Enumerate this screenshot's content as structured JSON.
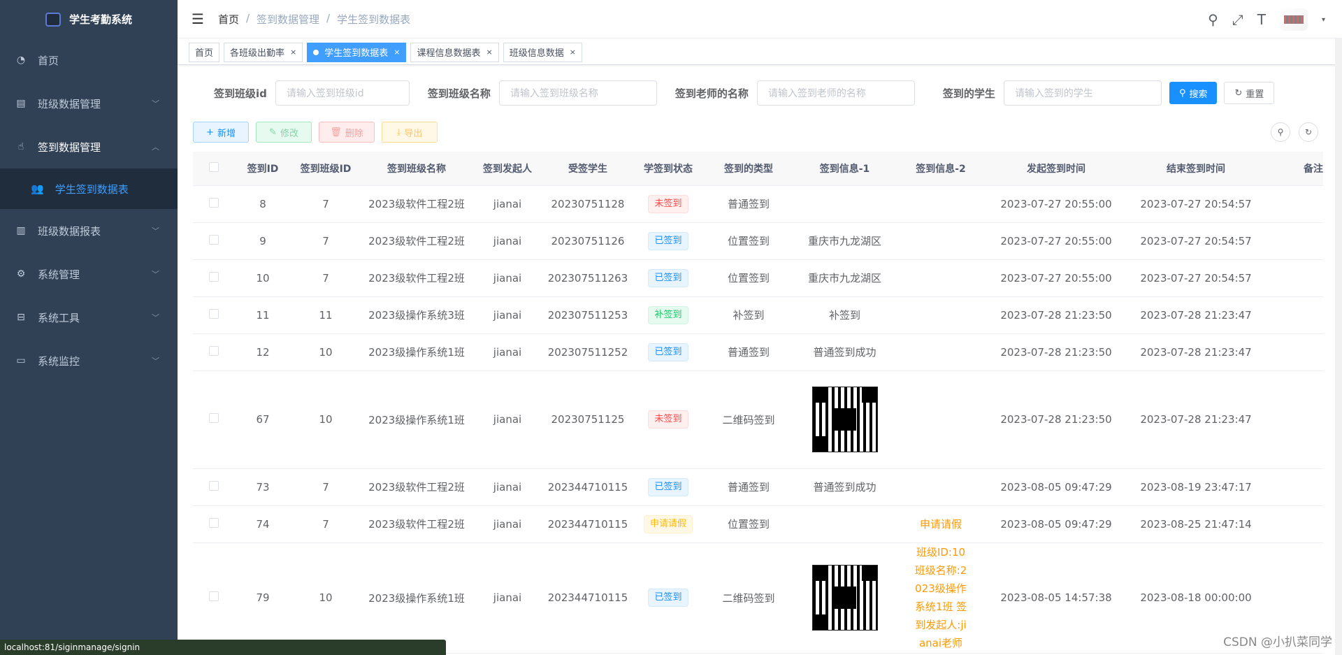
{
  "app": {
    "title": "学生考勤系统"
  },
  "sidebar": {
    "items": [
      {
        "label": "首页"
      },
      {
        "label": "班级数据管理"
      },
      {
        "label": "签到数据管理"
      },
      {
        "label": "学生签到数据表"
      },
      {
        "label": "班级数据报表"
      },
      {
        "label": "系统管理"
      },
      {
        "label": "系统工具"
      },
      {
        "label": "系统监控"
      }
    ]
  },
  "breadcrumb": {
    "home": "首页",
    "sep": "/",
    "level1": "签到数据管理",
    "level2": "学生签到数据表"
  },
  "tabs": [
    {
      "label": "首页"
    },
    {
      "label": "各班级出勤率"
    },
    {
      "label": "学生签到数据表"
    },
    {
      "label": "课程信息数据表"
    },
    {
      "label": "班级信息数据"
    }
  ],
  "search": {
    "f1_label": "签到班级id",
    "f1_placeholder": "请输入签到班级id",
    "f2_label": "签到班级名称",
    "f2_placeholder": "请输入签到班级名称",
    "f3_label": "签到老师的名称",
    "f3_placeholder": "请输入签到老师的名称",
    "f4_label": "签到的学生",
    "f4_placeholder": "请输入签到的学生",
    "search_btn": "搜索",
    "reset_btn": "重置"
  },
  "toolbar": {
    "add": "新增",
    "edit": "修改",
    "delete": "删除",
    "export": "导出"
  },
  "table": {
    "headers": [
      "签到ID",
      "签到班级ID",
      "签到班级名称",
      "签到发起人",
      "受签学生",
      "学签到状态",
      "签到的类型",
      "签到信息-1",
      "签到信息-2",
      "发起签到时间",
      "结束签到时间",
      "备注"
    ],
    "rows": [
      {
        "id": "8",
        "cls": "7",
        "name": "2023级软件工程2班",
        "init": "jianai",
        "stu": "20230751128",
        "status": "未签到",
        "type": "普通签到",
        "info1": "",
        "info2": "",
        "start": "2023-07-27 20:55:00",
        "end": "2023-07-27 20:54:57"
      },
      {
        "id": "9",
        "cls": "7",
        "name": "2023级软件工程2班",
        "init": "jianai",
        "stu": "20230751126",
        "status": "已签到",
        "type": "位置签到",
        "info1": "重庆市九龙湖区",
        "info2": "",
        "start": "2023-07-27 20:55:00",
        "end": "2023-07-27 20:54:57"
      },
      {
        "id": "10",
        "cls": "7",
        "name": "2023级软件工程2班",
        "init": "jianai",
        "stu": "202307511263",
        "status": "已签到",
        "type": "位置签到",
        "info1": "重庆市九龙湖区",
        "info2": "",
        "start": "2023-07-27 20:55:00",
        "end": "2023-07-27 20:54:57"
      },
      {
        "id": "11",
        "cls": "11",
        "name": "2023级操作系统3班",
        "init": "jianai",
        "stu": "202307511253",
        "status": "补签到",
        "type": "补签到",
        "info1": "补签到",
        "info2": "",
        "start": "2023-07-28 21:23:50",
        "end": "2023-07-28 21:23:47"
      },
      {
        "id": "12",
        "cls": "10",
        "name": "2023级操作系统1班",
        "init": "jianai",
        "stu": "202307511252",
        "status": "已签到",
        "type": "普通签到",
        "info1": "普通签到成功",
        "info2": "",
        "start": "2023-07-28 21:23:50",
        "end": "2023-07-28 21:23:47"
      },
      {
        "id": "67",
        "cls": "10",
        "name": "2023级操作系统1班",
        "init": "jianai",
        "stu": "20230751125",
        "status": "未签到",
        "type": "二维码签到",
        "info1": "",
        "info2": "",
        "start": "2023-07-28 21:23:50",
        "end": "2023-07-28 21:23:47"
      },
      {
        "id": "73",
        "cls": "7",
        "name": "2023级软件工程2班",
        "init": "jianai",
        "stu": "202344710115",
        "status": "已签到",
        "type": "普通签到",
        "info1": "普通签到成功",
        "info2": "",
        "start": "2023-08-05 09:47:29",
        "end": "2023-08-19 23:47:17"
      },
      {
        "id": "74",
        "cls": "7",
        "name": "2023级软件工程2班",
        "init": "jianai",
        "stu": "202344710115",
        "status": "申请请假",
        "type": "位置签到",
        "info1": "",
        "info2": "申请请假",
        "start": "2023-08-05 09:47:29",
        "end": "2023-08-25 21:47:14"
      },
      {
        "id": "79",
        "cls": "10",
        "name": "2023级操作系统1班",
        "init": "jianai",
        "stu": "202344710115",
        "status": "已签到",
        "type": "二维码签到",
        "info1": "",
        "info2_lines": [
          "班级ID:10",
          "班级名称:2",
          "023级操作",
          "系统1班 签",
          "到发起人:ji",
          "anai老师"
        ],
        "start": "2023-08-05 14:57:38",
        "end": "2023-08-18 00:00:00"
      }
    ]
  },
  "statusbar": {
    "url": "localhost:81/siginmanage/signin"
  },
  "watermark": "CSDN @小扒菜同学",
  "colors": {
    "sidebar": "#304156",
    "primary": "#1890ff",
    "active_tab": "#409eff"
  }
}
